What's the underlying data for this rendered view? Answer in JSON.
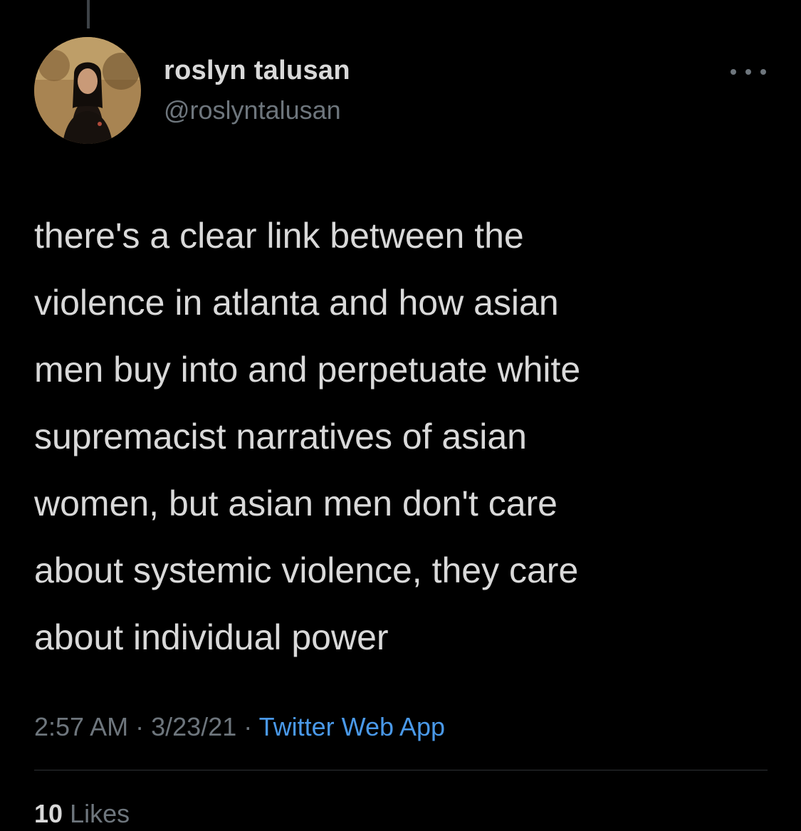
{
  "tweet": {
    "author": {
      "display_name": "roslyn talusan",
      "handle": "@roslyntalusan"
    },
    "text": "there's a clear link between the\nviolence in atlanta and how asian\nmen buy into and perpetuate white\nsupremacist narratives of asian\nwomen, but asian men don't care\nabout systemic violence, they care\nabout individual power",
    "time": "2:57 AM",
    "date": "3/23/21",
    "separator": "·",
    "source": "Twitter Web App",
    "likes_count": "10",
    "likes_label": "Likes"
  },
  "icons": {
    "more": "more-horizontal-icon"
  },
  "colors": {
    "background": "#000000",
    "primary_text": "#d9d9d9",
    "secondary_text": "#6e767d",
    "link": "#4a99e9",
    "divider": "#2f3336"
  }
}
